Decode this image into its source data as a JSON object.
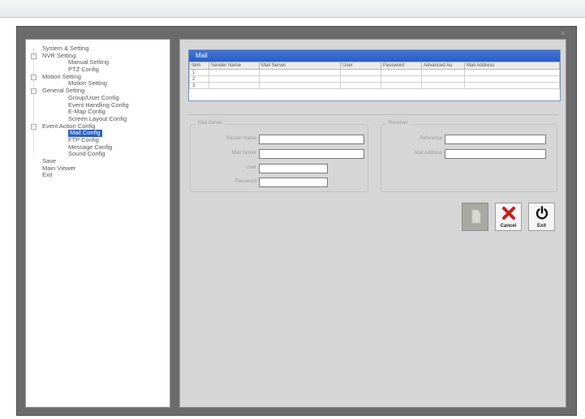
{
  "tree": [
    {
      "label": "System & Setting",
      "level": 0,
      "toggle": ""
    },
    {
      "label": "NVR Setting",
      "level": 0,
      "toggle": "-"
    },
    {
      "label": "Manual Setting",
      "level": 1,
      "toggle": ""
    },
    {
      "label": "PTZ Config",
      "level": 1,
      "toggle": ""
    },
    {
      "label": "Motion Setting",
      "level": 0,
      "toggle": "-"
    },
    {
      "label": "Motion Setting",
      "level": 1,
      "toggle": ""
    },
    {
      "label": "General Setting",
      "level": 0,
      "toggle": "-"
    },
    {
      "label": "Group/User Config",
      "level": 1,
      "toggle": ""
    },
    {
      "label": "Event Handling Config",
      "level": 1,
      "toggle": ""
    },
    {
      "label": "E-Map Config",
      "level": 1,
      "toggle": ""
    },
    {
      "label": "Screen Layout Config",
      "level": 1,
      "toggle": ""
    },
    {
      "label": "Event Action Config",
      "level": 0,
      "toggle": "-"
    },
    {
      "label": "Mail Config",
      "level": 1,
      "toggle": "",
      "selected": true
    },
    {
      "label": "FTP Config",
      "level": 1,
      "toggle": ""
    },
    {
      "label": "Message Config",
      "level": 1,
      "toggle": ""
    },
    {
      "label": "Sound Config",
      "level": 1,
      "toggle": ""
    },
    {
      "label": "Save",
      "level": 0,
      "toggle": ""
    },
    {
      "label": "Main Viewer",
      "level": 0,
      "toggle": ""
    },
    {
      "label": "Exit",
      "level": 0,
      "toggle": ""
    }
  ],
  "mail": {
    "title": "Mail",
    "columns": [
      "Item",
      "Sender Name",
      "Mail Server",
      "User",
      "Password",
      "Advanced Au",
      "Mail Address"
    ],
    "rows": [
      [
        "1",
        "",
        "",
        "",
        "",
        "",
        ""
      ],
      [
        "2",
        "",
        "",
        "",
        "",
        "",
        ""
      ],
      [
        "3",
        "",
        "",
        "",
        "",
        "",
        ""
      ]
    ]
  },
  "server_group": {
    "title": "Mail Server",
    "fields": [
      {
        "label": "Sender Name",
        "value": ""
      },
      {
        "label": "Mail Server",
        "value": ""
      },
      {
        "label": "User",
        "value": ""
      },
      {
        "label": "Password",
        "value": ""
      }
    ]
  },
  "receiver_group": {
    "title": "Receiver",
    "fields": [
      {
        "label": "Reference",
        "value": ""
      },
      {
        "label": "Mail Address",
        "value": ""
      }
    ]
  },
  "toolbar": {
    "apply_label": "",
    "cancel_label": "Cancel",
    "exit_label": "Exit"
  },
  "colors": {
    "cancel_icon": "#cc1c1c",
    "selected_bg": "#2a5fc6",
    "mail_header": "#2f66cc"
  }
}
